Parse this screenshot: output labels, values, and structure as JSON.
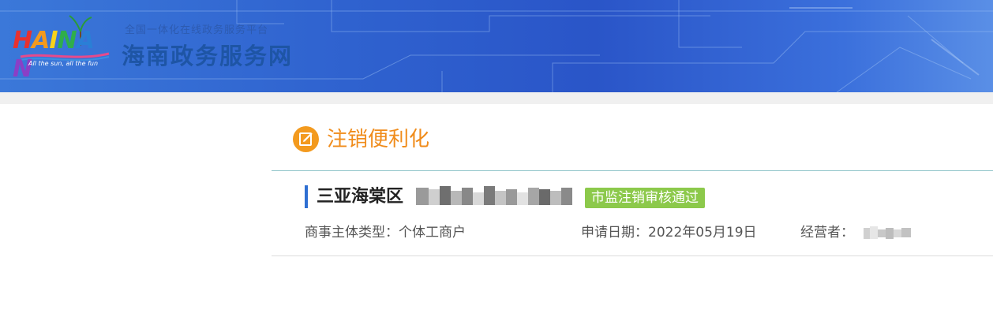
{
  "header": {
    "logo_text": "HAINAN",
    "logo_slogan": "All the sun, all the fun",
    "subtitle": "全国一体化在线政务服务平台",
    "title": "海南政务服务网"
  },
  "section": {
    "icon": "edit-icon",
    "title": "注销便利化"
  },
  "item": {
    "name": "三亚海棠区",
    "status": "市监注销审核通过",
    "type_label": "商事主体类型：",
    "type_value": "个体工商户",
    "date_label": "申请日期：",
    "date_value": "2022年05月19日",
    "operator_label": "经营者："
  },
  "colors": {
    "accent_orange": "#f08c1b",
    "status_green": "#8cc94b",
    "accent_blue": "#2f6fd2"
  }
}
